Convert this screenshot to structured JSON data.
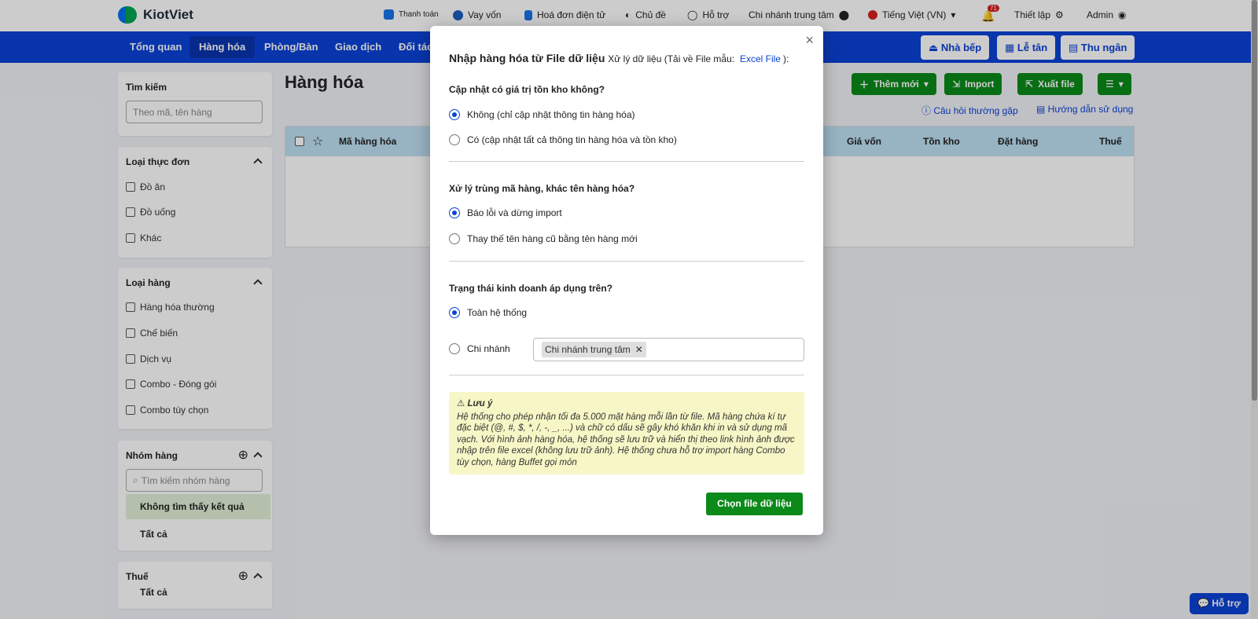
{
  "brand": {
    "name": "KiotViet"
  },
  "top": {
    "payment": "Thanh toán",
    "loan": "Vay vốn",
    "einvoice": "Hoá đơn điện tử",
    "theme": "Chủ đề",
    "support": "Hỗ trợ",
    "branch": "Chi nhánh trung tâm",
    "language": "Tiếng Việt (VN)",
    "notif_count": "71",
    "settings": "Thiết lập",
    "user": "Admin"
  },
  "nav": {
    "overview": "Tổng quan",
    "products": "Hàng hóa",
    "rooms": "Phòng/Bàn",
    "transactions": "Giao dịch",
    "partners": "Đối tác",
    "kitchen": "Nhà bếp",
    "reception": "Lễ tân",
    "cashier": "Thu ngân"
  },
  "sidebar": {
    "search_title": "Tìm kiếm",
    "search_placeholder": "Theo mã, tên hàng",
    "menu_type_title": "Loại thực đơn",
    "menu_types": [
      "Đồ ăn",
      "Đồ uống",
      "Khác"
    ],
    "product_type_title": "Loại hàng",
    "product_types": [
      "Hàng hóa thường",
      "Chế biến",
      "Dịch vụ",
      "Combo - Đóng gói",
      "Combo tùy chọn"
    ],
    "group_title": "Nhóm hàng",
    "group_search_placeholder": "Tìm kiếm nhóm hàng",
    "group_no_result": "Không tìm thấy kết quả",
    "group_all": "Tất cả",
    "tax_title": "Thuế",
    "tax_all": "Tất cả"
  },
  "main": {
    "title": "Hàng hóa",
    "add_new": "Thêm mới",
    "import": "Import",
    "export": "Xuất file",
    "faq": "Câu hỏi thường gặp",
    "guide": "Hướng dẫn sử dụng",
    "columns": {
      "code": "Mã hàng hóa",
      "cost": "Giá vốn",
      "stock": "Tồn kho",
      "order": "Đặt hàng",
      "tax": "Thuế"
    }
  },
  "modal": {
    "title": "Nhập hàng hóa từ File dữ liệu",
    "subtitle_prefix": "Xử lý dữ liệu (Tải về File mẫu:",
    "excel_link": "Excel File",
    "subtitle_suffix": "):",
    "q1": "Cập nhật có giá trị tồn kho không?",
    "q1_opt1": "Không (chỉ cập nhật thông tin hàng hóa)",
    "q1_opt2": "Có (cập nhật tất cả thông tin hàng hóa và tồn kho)",
    "q2": "Xử lý trùng mã hàng, khác tên hàng hóa?",
    "q2_opt1": "Báo lỗi và dừng import",
    "q2_opt2": "Thay thế tên hàng cũ bằng tên hàng mới",
    "q3": "Trạng thái kinh doanh áp dụng trên?",
    "q3_opt1": "Toàn hệ thống",
    "q3_opt2": "Chi nhánh",
    "branch_tag": "Chi nhánh trung tâm",
    "note_title": "Lưu ý",
    "note_text": "Hệ thống cho phép nhận tối đa 5.000 mặt hàng mỗi lần từ file. Mã hàng chứa kí tự đặc biệt (@, #, $, *, /, -, _, ...) và chữ có dấu sẽ gây khó khăn khi in và sử dụng mã vạch. Với hình ảnh hàng hóa, hệ thống sẽ lưu trữ và hiển thị theo link hình ảnh được nhập trên file excel (không lưu trữ ảnh). Hệ thống chưa hỗ trợ import hàng Combo tùy chọn, hàng Buffet gọi món",
    "choose_file": "Chọn file dữ liệu"
  },
  "support_btn": "Hỗ trợ",
  "colors": {
    "primary_blue": "#0b43d8",
    "primary_green": "#0b8a1a",
    "note_bg": "#f7f6c6"
  }
}
